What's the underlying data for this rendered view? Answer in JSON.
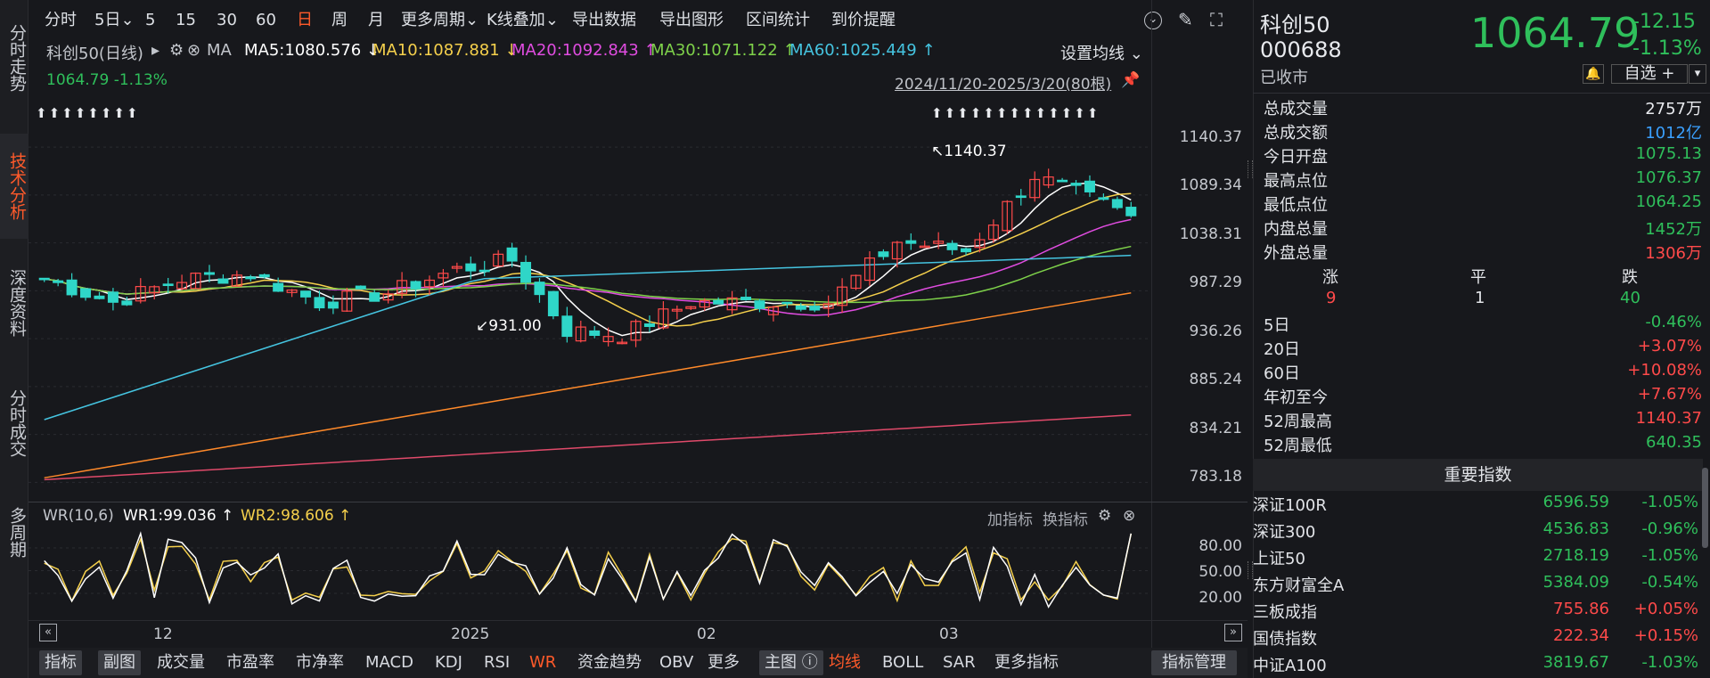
{
  "left_tabs": [
    "分时走势",
    "技术分析",
    "深度资料",
    "分时成交",
    "多周期"
  ],
  "active_tab": 1,
  "toolbar": {
    "periods": [
      "分时",
      "5日",
      "5",
      "15",
      "30",
      "60",
      "日",
      "周",
      "月",
      "更多周期",
      "K线叠加"
    ],
    "active_period": 6,
    "actions": [
      "导出数据",
      "导出图形",
      "区间统计",
      "到价提醒"
    ]
  },
  "legend": {
    "name": "科创50(日线)",
    "ma_label": "MA",
    "items": [
      {
        "text": "MA5:1080.576",
        "arrow": "↓",
        "color": "#ffffff"
      },
      {
        "text": "MA10:1087.881",
        "arrow": "↓",
        "color": "#f5d04c"
      },
      {
        "text": "MA20:1092.843",
        "arrow": "↑",
        "color": "#e04ce0"
      },
      {
        "text": "MA30:1071.122",
        "arrow": "↑",
        "color": "#7ed14a"
      },
      {
        "text": "MA60:1025.449",
        "arrow": "↑",
        "color": "#45c4e0"
      }
    ],
    "settings": "设置均线",
    "last": "1064.79  -1.13%",
    "range": "2024/11/20-2025/3/20(80根)",
    "high_label": "1140.37",
    "low_label": "931.00"
  },
  "y_axis": [
    "1140.37",
    "1089.34",
    "1038.31",
    "987.29",
    "936.26",
    "885.24",
    "834.21",
    "783.18"
  ],
  "x_axis": [
    "12",
    "2025",
    "02",
    "03"
  ],
  "wr": {
    "name": "WR(10,6)",
    "wr1": "WR1:99.036",
    "wr2": "WR2:98.606",
    "add": "加指标",
    "switch": "换指标",
    "ticks": [
      "80.00",
      "50.00",
      "20.00"
    ]
  },
  "bottom_tabs": [
    "指标",
    "副图",
    "成交量",
    "市盈率",
    "市净率",
    "MACD",
    "KDJ",
    "RSI",
    "WR",
    "资金趋势",
    "OBV",
    "更多",
    "主图",
    "均线",
    "BOLL",
    "SAR",
    "更多指标"
  ],
  "manage": "指标管理",
  "stock": {
    "name": "科创50",
    "code": "000688",
    "status": "已收市",
    "price": "1064.79",
    "change": "-12.15",
    "pct": "-1.13%",
    "watch": "自选 +"
  },
  "stats": [
    {
      "k": "总成交量",
      "v": "2757万",
      "c": "white"
    },
    {
      "k": "总成交额",
      "v": "1012亿",
      "c": "blue"
    },
    {
      "k": "今日开盘",
      "v": "1075.13",
      "c": "green"
    },
    {
      "k": "最高点位",
      "v": "1076.37",
      "c": "green"
    },
    {
      "k": "最低点位",
      "v": "1064.25",
      "c": "green"
    },
    {
      "k": "内盘总量",
      "v": "1452万",
      "c": "green"
    },
    {
      "k": "外盘总量",
      "v": "1306万",
      "c": "red2"
    }
  ],
  "breadth": {
    "labels": [
      "涨",
      "平",
      "跌"
    ],
    "values": [
      "9",
      "1",
      "40"
    ]
  },
  "perf": [
    {
      "k": "5日",
      "v": "-0.46%",
      "c": "green"
    },
    {
      "k": "20日",
      "v": "+3.07%",
      "c": "red2"
    },
    {
      "k": "60日",
      "v": "+10.08%",
      "c": "red2"
    },
    {
      "k": "年初至今",
      "v": "+7.67%",
      "c": "red2"
    },
    {
      "k": "52周最高",
      "v": "1140.37",
      "c": "red2"
    },
    {
      "k": "52周最低",
      "v": "640.35",
      "c": "green"
    }
  ],
  "indices_title": "重要指数",
  "indices": [
    {
      "n": "深证100R",
      "p": "6596.59",
      "c": "-1.05%",
      "col": "green"
    },
    {
      "n": "深证300",
      "p": "4536.83",
      "c": "-0.96%",
      "col": "green"
    },
    {
      "n": "上证50",
      "p": "2718.19",
      "c": "-1.05%",
      "col": "green"
    },
    {
      "n": "东方财富全A",
      "p": "5384.09",
      "c": "-0.54%",
      "col": "green"
    },
    {
      "n": "三板成指",
      "p": "755.86",
      "c": "+0.05%",
      "col": "red2"
    },
    {
      "n": "国债指数",
      "p": "222.34",
      "c": "+0.15%",
      "col": "red2"
    },
    {
      "n": "中证A100",
      "p": "3819.67",
      "c": "-1.03%",
      "col": "green"
    }
  ],
  "colors": {
    "up": "#ff4a4a",
    "down": "#2fd6c8",
    "bg": "#17181c",
    "accent": "#ff5a2a"
  }
}
